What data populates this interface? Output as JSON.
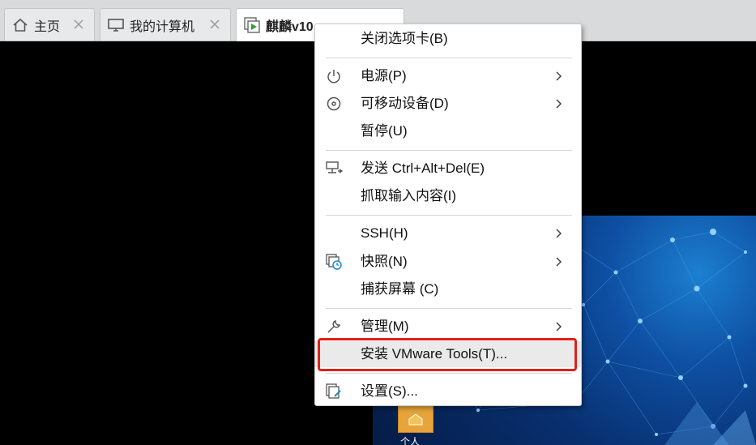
{
  "tabs": [
    {
      "label": "主页",
      "icon": "home-icon"
    },
    {
      "label": "我的计算机",
      "icon": "monitor-icon"
    },
    {
      "label": "麒麟v10",
      "icon": "vm-running-icon"
    }
  ],
  "context_menu": {
    "items": [
      {
        "label": "关闭选项卡(B)",
        "icon": null,
        "submenu": false
      },
      {
        "label": "电源(P)",
        "icon": "power-icon",
        "submenu": true
      },
      {
        "label": "可移动设备(D)",
        "icon": "disc-icon",
        "submenu": true
      },
      {
        "label": "暂停(U)",
        "icon": null,
        "submenu": false
      },
      {
        "label": "发送 Ctrl+Alt+Del(E)",
        "icon": "send-keys-icon",
        "submenu": false
      },
      {
        "label": "抓取输入内容(I)",
        "icon": null,
        "submenu": false
      },
      {
        "label": "SSH(H)",
        "icon": null,
        "submenu": true
      },
      {
        "label": "快照(N)",
        "icon": "snapshot-icon",
        "submenu": true
      },
      {
        "label": "捕获屏幕 (C)",
        "icon": null,
        "submenu": false
      },
      {
        "label": "管理(M)",
        "icon": "wrench-icon",
        "submenu": true
      },
      {
        "label": "安装 VMware Tools(T)...",
        "icon": null,
        "submenu": false
      },
      {
        "label": "设置(S)...",
        "icon": "settings-icon",
        "submenu": false
      }
    ],
    "highlighted_item": "安装 VMware Tools(T)..."
  },
  "desktop": {
    "icon_label": "个人"
  },
  "colors": {
    "highlight_border": "#e0201b",
    "desktop_blue": "#0e4fa2",
    "vm_accent": "#2aa13a"
  }
}
